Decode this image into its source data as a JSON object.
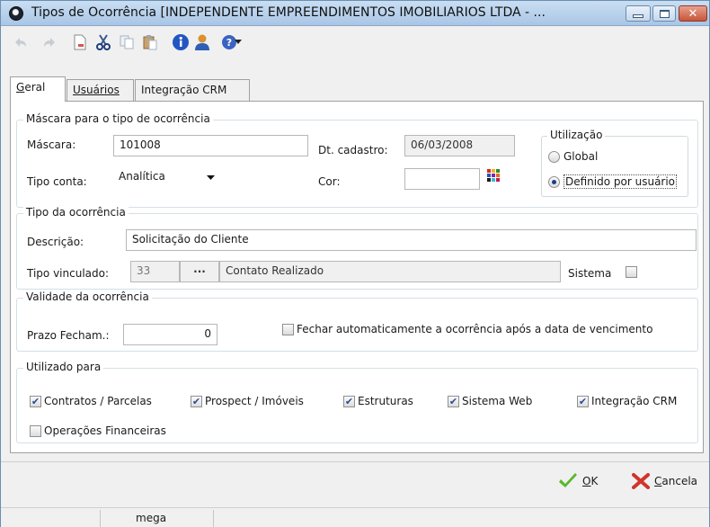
{
  "window": {
    "title": "Tipos de Ocorrência [INDEPENDENTE EMPREENDIMENTOS IMOBILIARIOS LTDA - ..."
  },
  "toolbar": {
    "icons": [
      "undo-icon",
      "redo-icon",
      "new-document-icon",
      "cut-icon",
      "copy-icon",
      "paste-icon",
      "info-icon",
      "user-icon",
      "help-icon",
      "dropdown-arrow-icon"
    ]
  },
  "tabs": [
    {
      "label": "Geral",
      "mnemonic": "G",
      "rest": "eral"
    },
    {
      "label": "Usuários",
      "mnemonic": "U",
      "rest": "suários"
    },
    {
      "label": "Integração CRM"
    }
  ],
  "mascara_group": {
    "title": "Máscara para o tipo de ocorrência",
    "mascara_label": "Máscara:",
    "mascara_value": "101008",
    "dt_cadastro_label": "Dt. cadastro:",
    "dt_cadastro_value": "06/03/2008",
    "tipo_conta_label": "Tipo conta:",
    "tipo_conta_value": "Analítica",
    "cor_label": "Cor:",
    "cor_value": ""
  },
  "utilizacao": {
    "title": "Utilização",
    "options": [
      "Global",
      "Definido por usuário"
    ],
    "selected": "Definido por usuário"
  },
  "tipo_ocorrencia": {
    "title": "Tipo da ocorrência",
    "descricao_label": "Descrição:",
    "descricao_value": "Solicitação do Cliente",
    "tipo_vinculado_label": "Tipo vinculado:",
    "tipo_vinculado_code": "33",
    "browse_label": "...",
    "tipo_vinculado_name": "Contato Realizado",
    "sistema_label": "Sistema",
    "sistema_checked": false
  },
  "validade": {
    "title": "Validade da ocorrência",
    "prazo_label": "Prazo Fecham.:",
    "prazo_value": "0",
    "auto_close_label": "Fechar automaticamente a ocorrência após a data de vencimento",
    "auto_close_checked": false
  },
  "utilizado_para": {
    "title": "Utilizado para",
    "contratos": "Contratos / Parcelas",
    "prospect": "Prospect / Imóveis",
    "estruturas": "Estruturas",
    "sistema_web": "Sistema Web",
    "integracao_crm": "Integração CRM",
    "operacoes": "Operações Financeiras"
  },
  "actions": {
    "ok_label": "OK",
    "ok_rest": "K",
    "cancel_label": "Cancela",
    "cancel_rest": "ancela"
  },
  "statusbar": {
    "user": "mega"
  },
  "colors": {
    "accent": "#1b3f86",
    "ok_green": "#58b82e",
    "cancel_red": "#d0342c"
  }
}
